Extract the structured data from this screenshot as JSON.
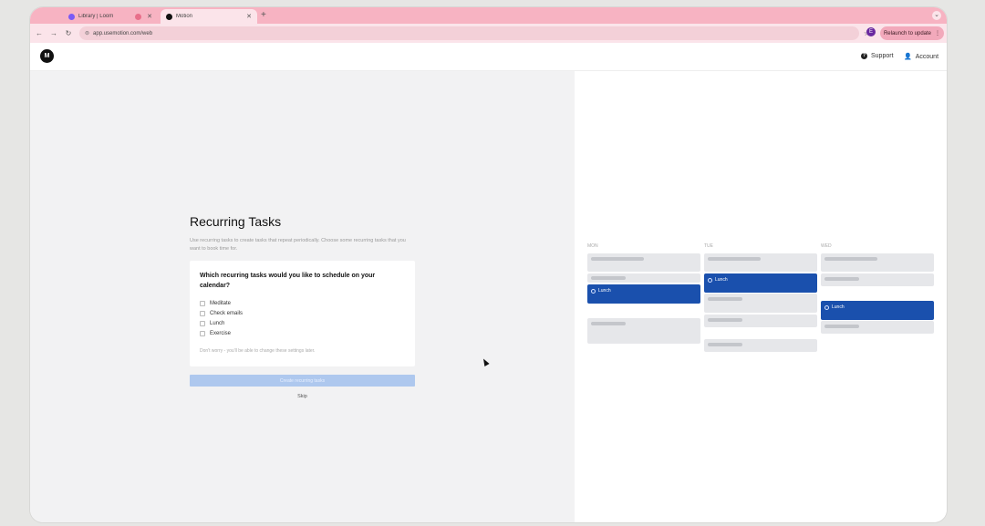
{
  "browser": {
    "tabs": [
      {
        "title": "Library | Loom",
        "active": false,
        "favicon_color": "#7a5af5"
      },
      {
        "title": "Motion",
        "active": true,
        "favicon_color": "#111111"
      }
    ],
    "new_tab_symbol": "+",
    "url": "app.usemotion.com/web",
    "relaunch_label": "Relaunch to update",
    "profile_initial": "E"
  },
  "app": {
    "logo_letter": "M",
    "support_label": "Support",
    "account_label": "Account"
  },
  "onboarding": {
    "title": "Recurring Tasks",
    "description": "Use recurring tasks to create tasks that repeat periodically. Choose some recurring tasks that you want to book time for.",
    "question": "Which recurring tasks would you like to schedule on your calendar?",
    "options": [
      {
        "label": "Meditate",
        "checked": false
      },
      {
        "label": "Check emails",
        "checked": false
      },
      {
        "label": "Lunch",
        "checked": false
      },
      {
        "label": "Exercise",
        "checked": false
      }
    ],
    "note": "Don't worry - you'll be able to change these settings later.",
    "create_button": "Create recurring tasks",
    "skip_link": "Skip"
  },
  "calendar": {
    "days": [
      {
        "label": "MON",
        "event_label": "Lunch"
      },
      {
        "label": "TUE",
        "event_label": "Lunch"
      },
      {
        "label": "WED",
        "event_label": "Lunch"
      }
    ],
    "colors": {
      "event": "#1a50ad",
      "placeholder": "#e6e7ea"
    }
  }
}
